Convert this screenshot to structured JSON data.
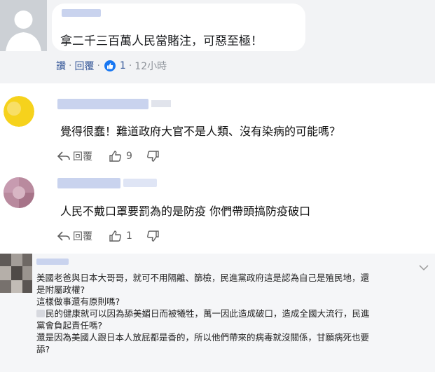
{
  "comments": {
    "c1": {
      "text": "拿二千三百萬人民當賭注，可惡至極！",
      "actions": {
        "read": "讚",
        "reply": "回覆",
        "like_count": "1",
        "time": "12小時"
      }
    },
    "c2": {
      "text": "覺得很蠢！難道政府大官不是人類、沒有染病的可能嗎？",
      "reply_label": "回覆",
      "like_count": "9"
    },
    "c3": {
      "text": "人民不戴口罩要罰為的是防疫 你們帶頭搞防疫破口",
      "reply_label": "回覆",
      "like_count": "1"
    },
    "c4": {
      "lines": [
        "美國老爸與日本大哥哥，就可不用隔離、篩檢，民進黨政府這是認為自己是殖民地，還",
        "是附屬政權?",
        "這樣做事還有原則嗎?",
        "民的健康就可以因為舔美媚日而被犧牲，萬一因此造成破口，造成全國大流行，民進",
        "黨會負起責任嗎?",
        "還是因為美國人跟日本人放屁都是香的，所以他們帶來的病毒就沒關係，甘願病死也要",
        "舔?"
      ]
    }
  },
  "icons": {
    "like_badge": "thumbs-up-icon",
    "reply": "reply-arrow-icon",
    "like": "thumbs-up-outline-icon",
    "dislike": "thumbs-down-outline-icon",
    "menu": "chevron-down-icon"
  },
  "colors": {
    "link": "#365899",
    "meta": "#8f949b",
    "like_badge": "#1877f2",
    "yt_meta": "#606060"
  }
}
